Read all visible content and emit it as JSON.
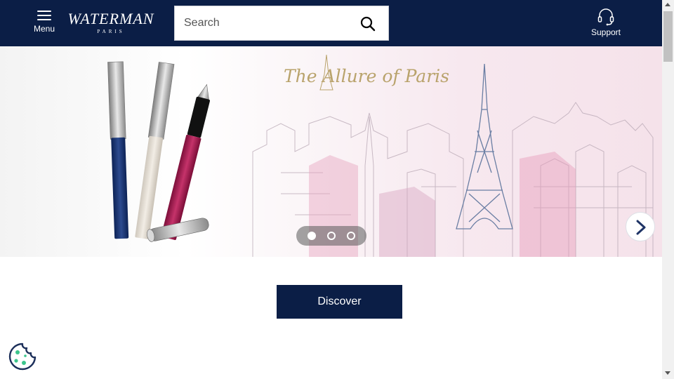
{
  "header": {
    "menu_label": "Menu",
    "logo_word": "WATERMAN",
    "logo_sub": "PARIS",
    "search_placeholder": "Search",
    "support_label": "Support",
    "background_color": "#0b1e46"
  },
  "banner": {
    "tagline": "The Allure of Paris",
    "slides": [
      {
        "active": true
      },
      {
        "active": false
      },
      {
        "active": false
      }
    ]
  },
  "cta": {
    "discover_label": "Discover"
  },
  "icons": {
    "menu": "hamburger-icon",
    "search": "search-icon",
    "support": "headset-icon",
    "next": "chevron-right-icon",
    "cookie": "cookie-icon"
  }
}
